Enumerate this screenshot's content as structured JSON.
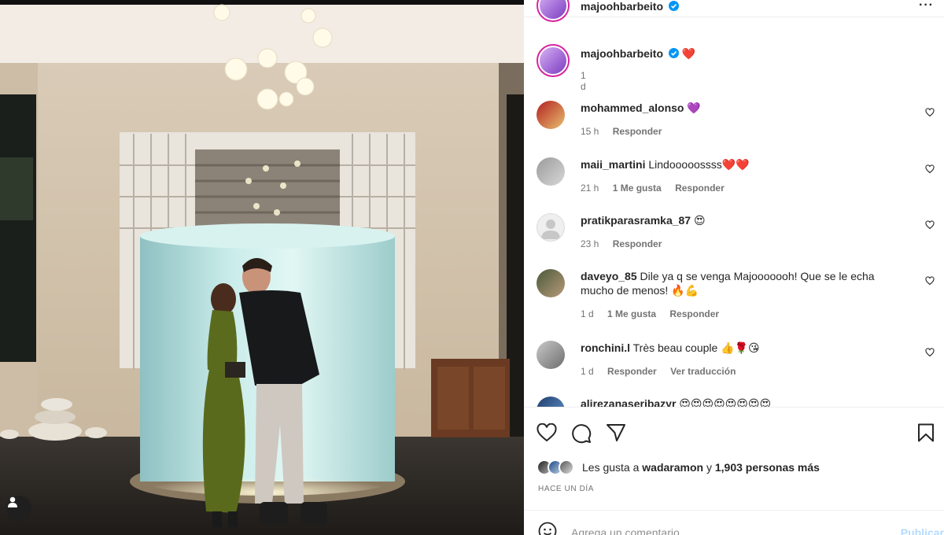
{
  "post": {
    "author": "majoohbarbeito",
    "verified": true,
    "more_icon": "more-horizontal-icon"
  },
  "caption": {
    "author": "majoohbarbeito",
    "text": "❤️",
    "time": "1 d"
  },
  "comments": [
    {
      "user": "mohammed_alonso",
      "text": "💜",
      "time": "15 h",
      "likes": "",
      "reply": "Responder",
      "translate": ""
    },
    {
      "user": "maii_martini",
      "text": "Lindooooossss❤️❤️",
      "time": "21 h",
      "likes": "1 Me gusta",
      "reply": "Responder",
      "translate": ""
    },
    {
      "user": "pratikparasramka_87",
      "text": "😍",
      "time": "23 h",
      "likes": "",
      "reply": "Responder",
      "translate": ""
    },
    {
      "user": "daveyo_85",
      "text": "Dile ya q se venga Majooooooh! Que se le echa mucho de menos! 🔥💪",
      "time": "1 d",
      "likes": "1 Me gusta",
      "reply": "Responder",
      "translate": ""
    },
    {
      "user": "ronchini.l",
      "text": "Très beau couple 👍🌹😘",
      "time": "1 d",
      "likes": "",
      "reply": "Responder",
      "translate": "Ver traducción"
    },
    {
      "user": "alirezanaseribazyr",
      "text": "😍😍😍😍😍😍😍😍",
      "time": "",
      "likes": "",
      "reply": "",
      "translate": ""
    }
  ],
  "likes": {
    "prefix": "Les gusta a",
    "user": "wadaramon",
    "middle": "y",
    "count": "1,903 personas más"
  },
  "time_ago": "HACE UN DÍA",
  "add_comment": {
    "placeholder": "Agrega un comentario...",
    "submit": "Publicar"
  },
  "colors": {
    "story_ring": "#d6249f",
    "verified": "#0095f6",
    "publish_disabled": "#b3dbff",
    "muted": "#737373"
  }
}
